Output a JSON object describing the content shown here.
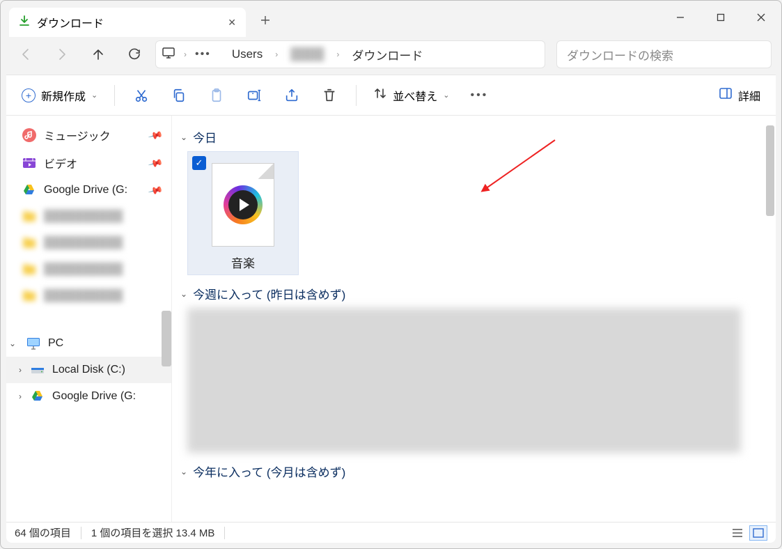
{
  "tab": {
    "title": "ダウンロード"
  },
  "breadcrumb": {
    "users": "Users",
    "hidden_user": "████",
    "downloads": "ダウンロード"
  },
  "search": {
    "placeholder": "ダウンロードの検索"
  },
  "toolbar": {
    "new_label": "新規作成",
    "sort_label": "並べ替え",
    "details_label": "詳細"
  },
  "sidebar": {
    "items": [
      {
        "label": "ミュージック",
        "icon": "music",
        "pinned": true
      },
      {
        "label": "ビデオ",
        "icon": "video",
        "pinned": true
      },
      {
        "label": "Google Drive (G:",
        "icon": "gdrive",
        "pinned": true
      }
    ],
    "pc_label": "PC",
    "local_disk_label": "Local Disk (C:)",
    "gdrive_label": "Google Drive (G:"
  },
  "groups": {
    "today": "今日",
    "this_week": "今週に入って (昨日は含めず)",
    "this_year": "今年に入って (今月は含めず)"
  },
  "file": {
    "name": "音楽"
  },
  "status": {
    "item_count": "64 個の項目",
    "selection": "1 個の項目を選択 13.4 MB"
  }
}
